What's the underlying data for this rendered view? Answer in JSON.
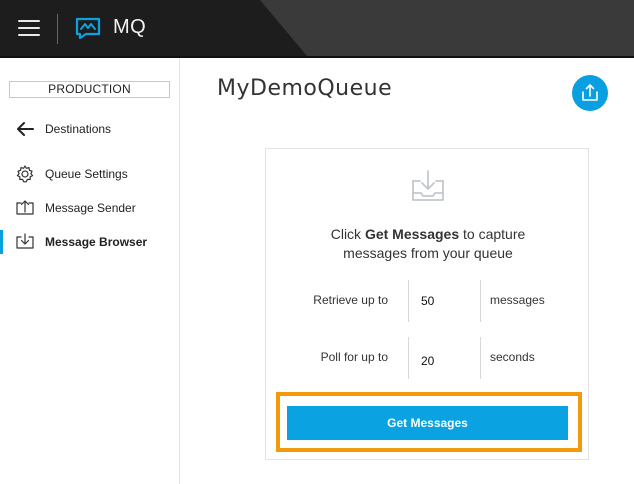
{
  "header": {
    "brand": "MQ",
    "menu_icon": "hamburger-menu-icon",
    "logo_icon": "mq-logo-icon"
  },
  "sidebar": {
    "environment": "PRODUCTION",
    "back_item": {
      "label": "Destinations",
      "icon": "arrow-left-icon"
    },
    "items": [
      {
        "label": "Queue Settings",
        "icon": "gear-icon",
        "active": false
      },
      {
        "label": "Message Sender",
        "icon": "upload-tray-icon",
        "active": false
      },
      {
        "label": "Message Browser",
        "icon": "download-tray-icon",
        "active": true
      }
    ]
  },
  "main": {
    "title": "MyDemoQueue",
    "export_icon": "export-upload-icon",
    "card": {
      "icon": "inbox-download-icon",
      "hint_prefix": "Click ",
      "hint_action": "Get Messages",
      "hint_suffix": " to capture",
      "hint_line2": "messages from your queue",
      "retrieve": {
        "label": "Retrieve up to",
        "value": "50",
        "unit": "messages"
      },
      "poll": {
        "label": "Poll for up to",
        "value": "20",
        "unit": "seconds"
      },
      "button_label": "Get Messages"
    }
  },
  "colors": {
    "accent": "#0aa2e0",
    "highlight": "#f29a0b",
    "topbar": "#1d1d1d"
  }
}
